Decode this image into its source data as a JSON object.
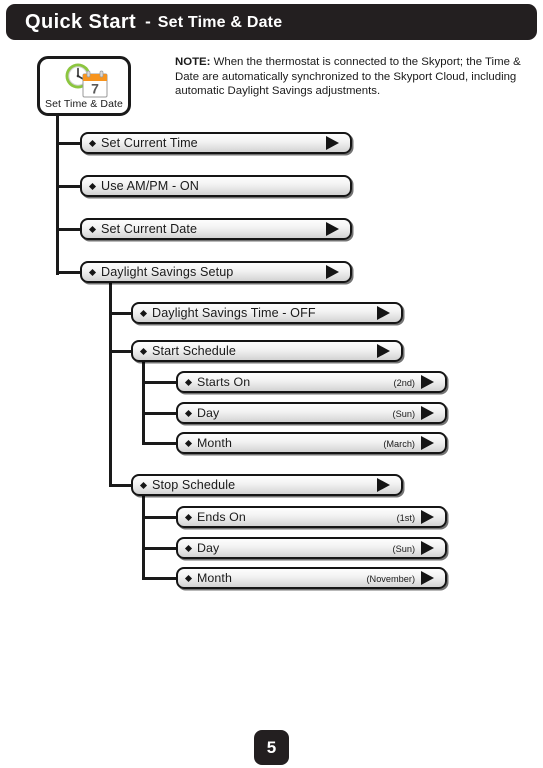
{
  "header": {
    "title": "Quick Start",
    "separator": "-",
    "subtitle": "Set Time & Date"
  },
  "icon_card": {
    "label": "Set Time & Date",
    "icon_name": "clock-calendar-icon",
    "calendar_day": "7",
    "clock_color": "#7bc043",
    "calendar_header_color": "#f7941e"
  },
  "note": {
    "prefix": "NOTE:",
    "text": " When the thermostat is connected to the Skyport; the Time & Date are automatically synchronized to the Skyport Cloud, including automatic Daylight Savings adjustments."
  },
  "menu": {
    "level1": [
      {
        "label": "Set Current Time",
        "value": "",
        "arrow": true
      },
      {
        "label": "Use AM/PM - ON",
        "value": "",
        "arrow": false
      },
      {
        "label": "Set Current Date",
        "value": "",
        "arrow": true
      },
      {
        "label": "Daylight Savings Setup",
        "value": "",
        "arrow": true
      }
    ],
    "level2": [
      {
        "label": "Daylight Savings Time - OFF",
        "value": "",
        "arrow": true
      },
      {
        "label": "Start Schedule",
        "value": "",
        "arrow": true
      },
      {
        "label": "Stop Schedule",
        "value": "",
        "arrow": true
      }
    ],
    "start_children": [
      {
        "label": "Starts On",
        "value": "(2nd)",
        "arrow": true
      },
      {
        "label": "Day",
        "value": "(Sun)",
        "arrow": true
      },
      {
        "label": "Month",
        "value": "(March)",
        "arrow": true
      }
    ],
    "stop_children": [
      {
        "label": "Ends On",
        "value": "(1st)",
        "arrow": true
      },
      {
        "label": "Day",
        "value": "(Sun)",
        "arrow": true
      },
      {
        "label": "Month",
        "value": "(November)",
        "arrow": true
      }
    ]
  },
  "footer": {
    "page_number": "5"
  },
  "colors": {
    "ink": "#231f20",
    "bar_outline": "#151515",
    "page_background": "#ffffff"
  }
}
